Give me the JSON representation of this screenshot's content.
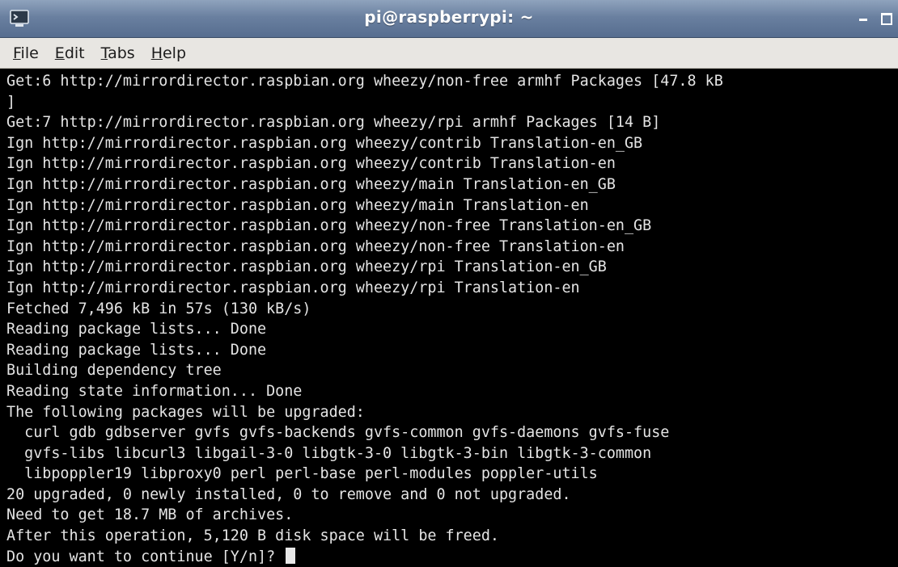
{
  "window": {
    "title": "pi@raspberrypi: ~"
  },
  "menu": {
    "items": [
      {
        "first": "F",
        "rest": "ile"
      },
      {
        "first": "E",
        "rest": "dit"
      },
      {
        "first": "T",
        "rest": "abs"
      },
      {
        "first": "H",
        "rest": "elp"
      }
    ]
  },
  "icons": {
    "app": "terminal-icon",
    "minimize": "minimize-icon",
    "maximize": "maximize-icon"
  },
  "colors": {
    "titlebar": "#6a80a0",
    "menubar": "#e8e6e2",
    "terminal_bg": "#000000",
    "terminal_fg": "#e4e4e4"
  },
  "terminal": {
    "lines": [
      "Get:6 http://mirrordirector.raspbian.org wheezy/non-free armhf Packages [47.8 kB",
      "]",
      "Get:7 http://mirrordirector.raspbian.org wheezy/rpi armhf Packages [14 B]",
      "Ign http://mirrordirector.raspbian.org wheezy/contrib Translation-en_GB",
      "Ign http://mirrordirector.raspbian.org wheezy/contrib Translation-en",
      "Ign http://mirrordirector.raspbian.org wheezy/main Translation-en_GB",
      "Ign http://mirrordirector.raspbian.org wheezy/main Translation-en",
      "Ign http://mirrordirector.raspbian.org wheezy/non-free Translation-en_GB",
      "Ign http://mirrordirector.raspbian.org wheezy/non-free Translation-en",
      "Ign http://mirrordirector.raspbian.org wheezy/rpi Translation-en_GB",
      "Ign http://mirrordirector.raspbian.org wheezy/rpi Translation-en",
      "Fetched 7,496 kB in 57s (130 kB/s)",
      "Reading package lists... Done",
      "Reading package lists... Done",
      "Building dependency tree",
      "Reading state information... Done",
      "The following packages will be upgraded:",
      "  curl gdb gdbserver gvfs gvfs-backends gvfs-common gvfs-daemons gvfs-fuse",
      "  gvfs-libs libcurl3 libgail-3-0 libgtk-3-0 libgtk-3-bin libgtk-3-common",
      "  libpoppler19 libproxy0 perl perl-base perl-modules poppler-utils",
      "20 upgraded, 0 newly installed, 0 to remove and 0 not upgraded.",
      "Need to get 18.7 MB of archives.",
      "After this operation, 5,120 B disk space will be freed."
    ],
    "prompt": "Do you want to continue [Y/n]? "
  }
}
